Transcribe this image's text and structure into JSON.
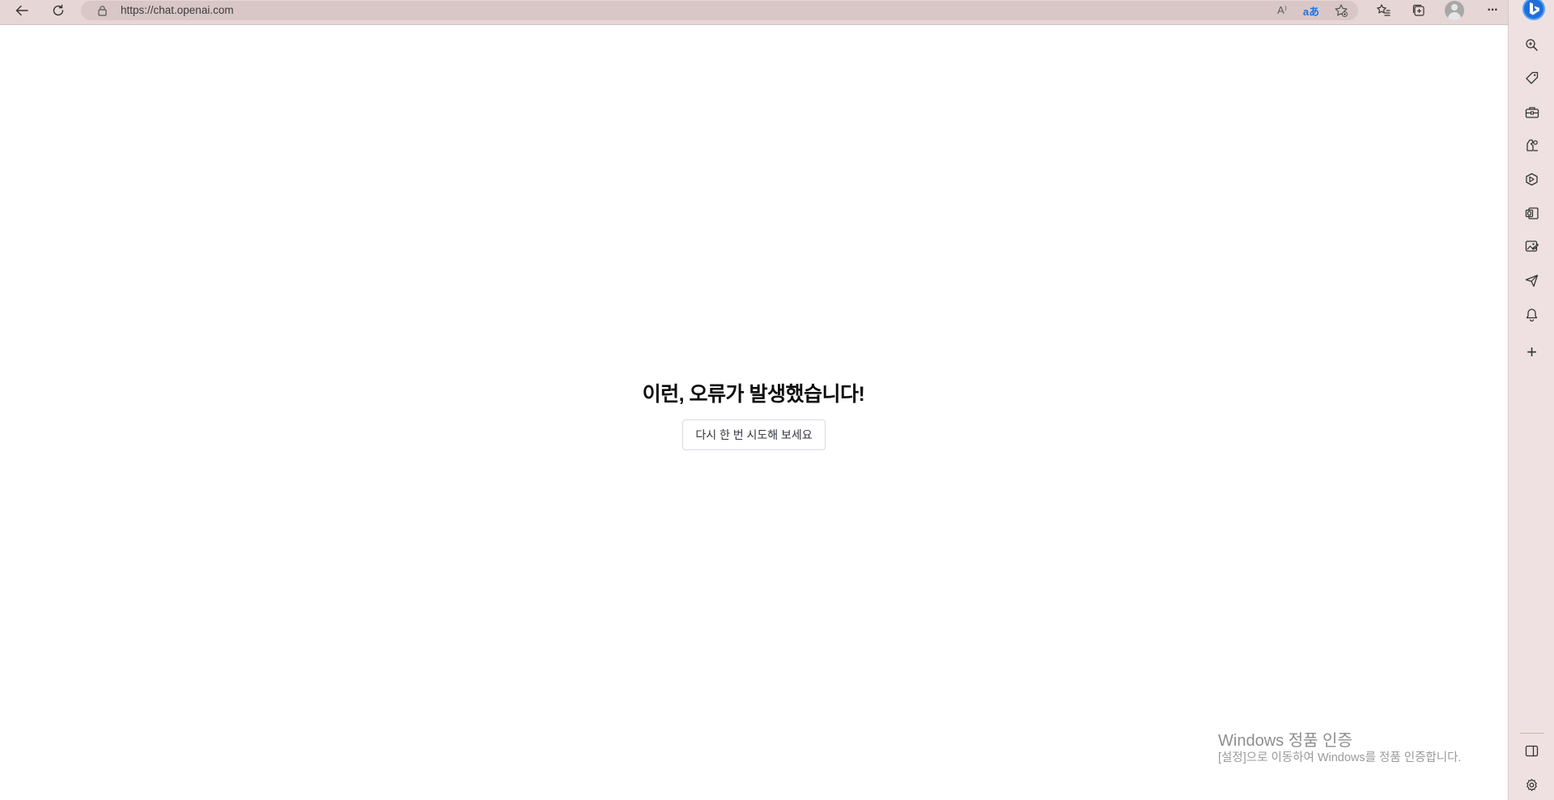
{
  "browser": {
    "url": "https://chat.openai.com",
    "toolbar_icons": [
      "back-icon",
      "refresh-icon",
      "lock-icon",
      "read-aloud-icon",
      "translate-icon",
      "add-favorite-icon",
      "favorites-icon",
      "collections-icon",
      "profile-avatar",
      "more-icon"
    ],
    "read_aloud_label": "A⁾",
    "translate_label": "aあ",
    "more_label": "···"
  },
  "sidebar": {
    "icons": [
      "bing-icon",
      "search-icon",
      "shopping-tag-icon",
      "tools-icon",
      "games-icon",
      "office-icon",
      "outlook-icon",
      "image-creator-icon",
      "send-icon",
      "notification-bell-icon",
      "add-icon",
      "split-screen-icon",
      "settings-icon"
    ],
    "add_label": "+"
  },
  "page": {
    "error_title": "이런, 오류가 발생했습니다!",
    "retry_button": "다시 한 번 시도해 보세요"
  },
  "watermark": {
    "title": "Windows 정품 인증",
    "subtitle": "[설정]으로 이동하여 Windows를 정품 인증합니다."
  },
  "colors": {
    "toolbar_bg": "#e7d6d6",
    "sidebar_bg": "#efe1e1",
    "bing_blue": "#1f6fd8",
    "translate_blue": "#1a73e8"
  }
}
